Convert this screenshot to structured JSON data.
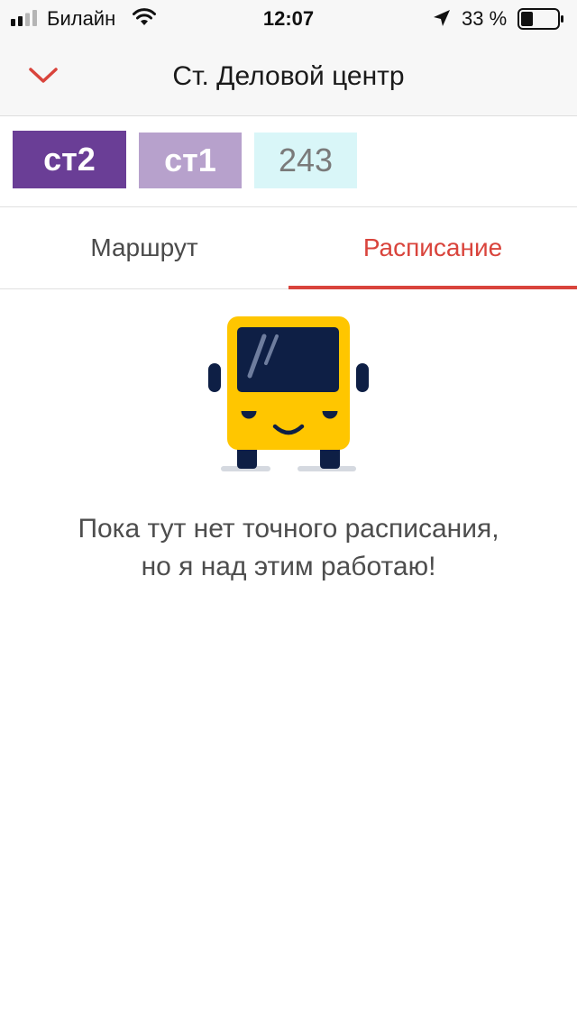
{
  "status_bar": {
    "carrier": "Билайн",
    "time": "12:07",
    "battery_percent": "33 %",
    "icons": [
      "signal-icon",
      "wifi-icon",
      "location-arrow-icon",
      "battery-icon"
    ]
  },
  "header": {
    "title": "Ст. Деловой центр",
    "back_icon": "chevron-down-icon"
  },
  "routes": [
    {
      "label": "ст2",
      "color": "#6a3e96",
      "text_color": "#ffffff"
    },
    {
      "label": "ст1",
      "color": "#b7a1cc",
      "text_color": "#ffffff"
    },
    {
      "label": "243",
      "color": "#d9f6f8",
      "text_color": "#7a7a7a"
    }
  ],
  "tabs": [
    {
      "label": "Маршрут",
      "active": false
    },
    {
      "label": "Расписание",
      "active": true
    }
  ],
  "empty_state": {
    "illustration": "bus-icon",
    "line1": "Пока тут нет точного расписания,",
    "line2": "но я над этим работаю!"
  },
  "colors": {
    "accent": "#d9443c",
    "bus_yellow": "#ffc600",
    "bus_navy": "#0e1f45"
  }
}
